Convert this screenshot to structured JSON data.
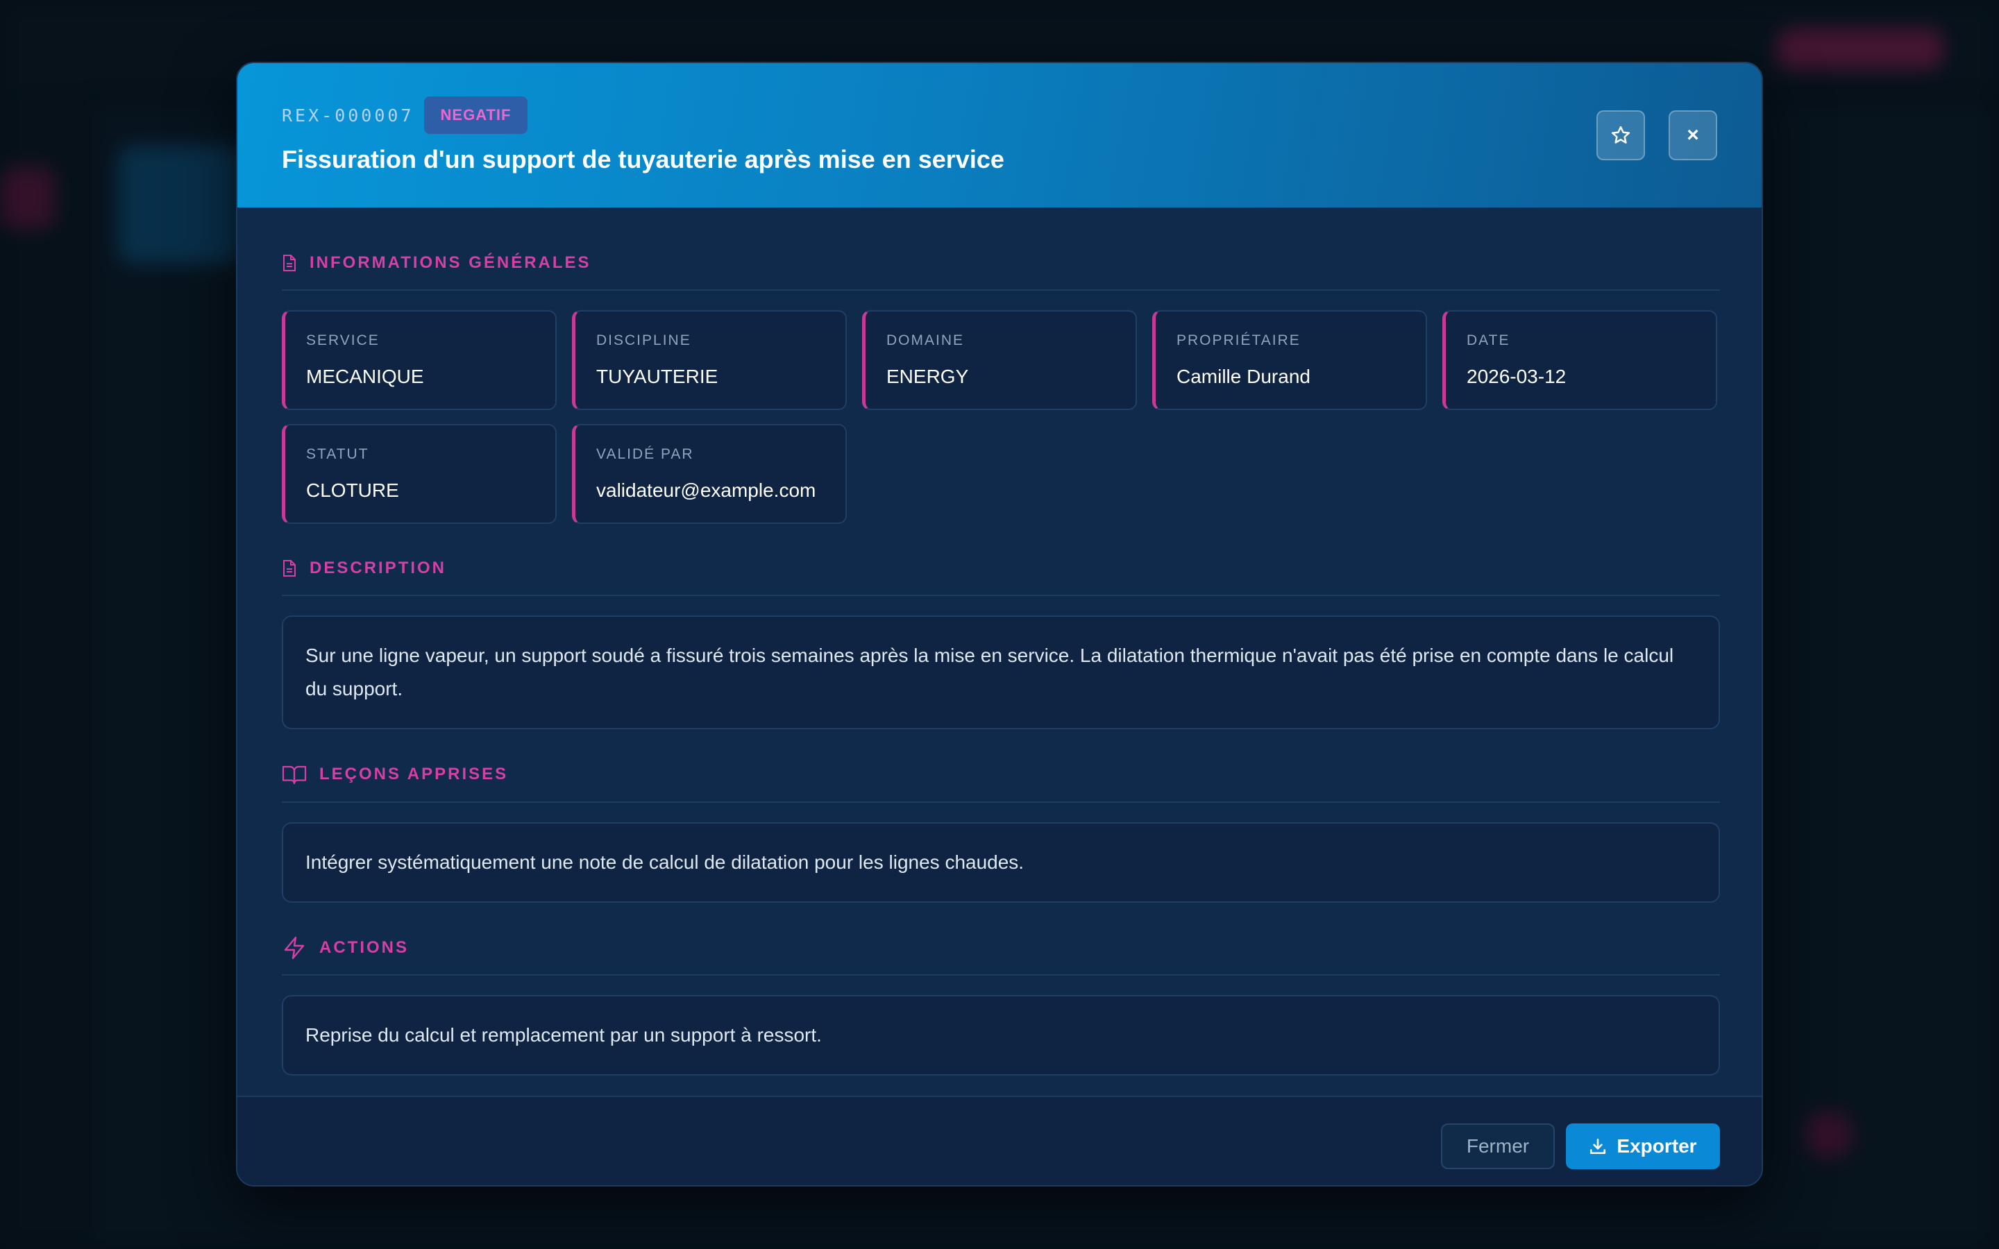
{
  "modal": {
    "reference": "REX-000007",
    "badge": "NEGATIF",
    "title": "Fissuration d'un support de tuyauterie après mise en service",
    "star_icon": "star-icon",
    "close_label": "×"
  },
  "sections": {
    "general": {
      "title": "INFORMATIONS GÉNÉRALES",
      "fields": [
        {
          "label": "SERVICE",
          "value": "MECANIQUE"
        },
        {
          "label": "DISCIPLINE",
          "value": "TUYAUTERIE"
        },
        {
          "label": "DOMAINE",
          "value": "ENERGY"
        },
        {
          "label": "PROPRIÉTAIRE",
          "value": "Camille Durand"
        },
        {
          "label": "DATE",
          "value": "2026-03-12"
        },
        {
          "label": "STATUT",
          "value": "CLOTURE"
        },
        {
          "label": "VALIDÉ PAR",
          "value": "validateur@example.com"
        }
      ]
    },
    "description": {
      "title": "DESCRIPTION",
      "text": "Sur une ligne vapeur, un support soudé a fissuré trois semaines après la mise en service. La dilatation thermique n'avait pas été prise en compte dans le calcul du support."
    },
    "lessons": {
      "title": "LEÇONS APPRISES",
      "text": "Intégrer systématiquement une note de calcul de dilatation pour les lignes chaudes."
    },
    "actions": {
      "title": "ACTIONS",
      "text": "Reprise du calcul et remplacement par un support à ressort."
    }
  },
  "footer": {
    "close_label": "Fermer",
    "export_label": "Exporter"
  },
  "colors": {
    "accent": "#d63fa5",
    "primary": "#0a8ad6",
    "modal_bg": "#102a4c"
  }
}
